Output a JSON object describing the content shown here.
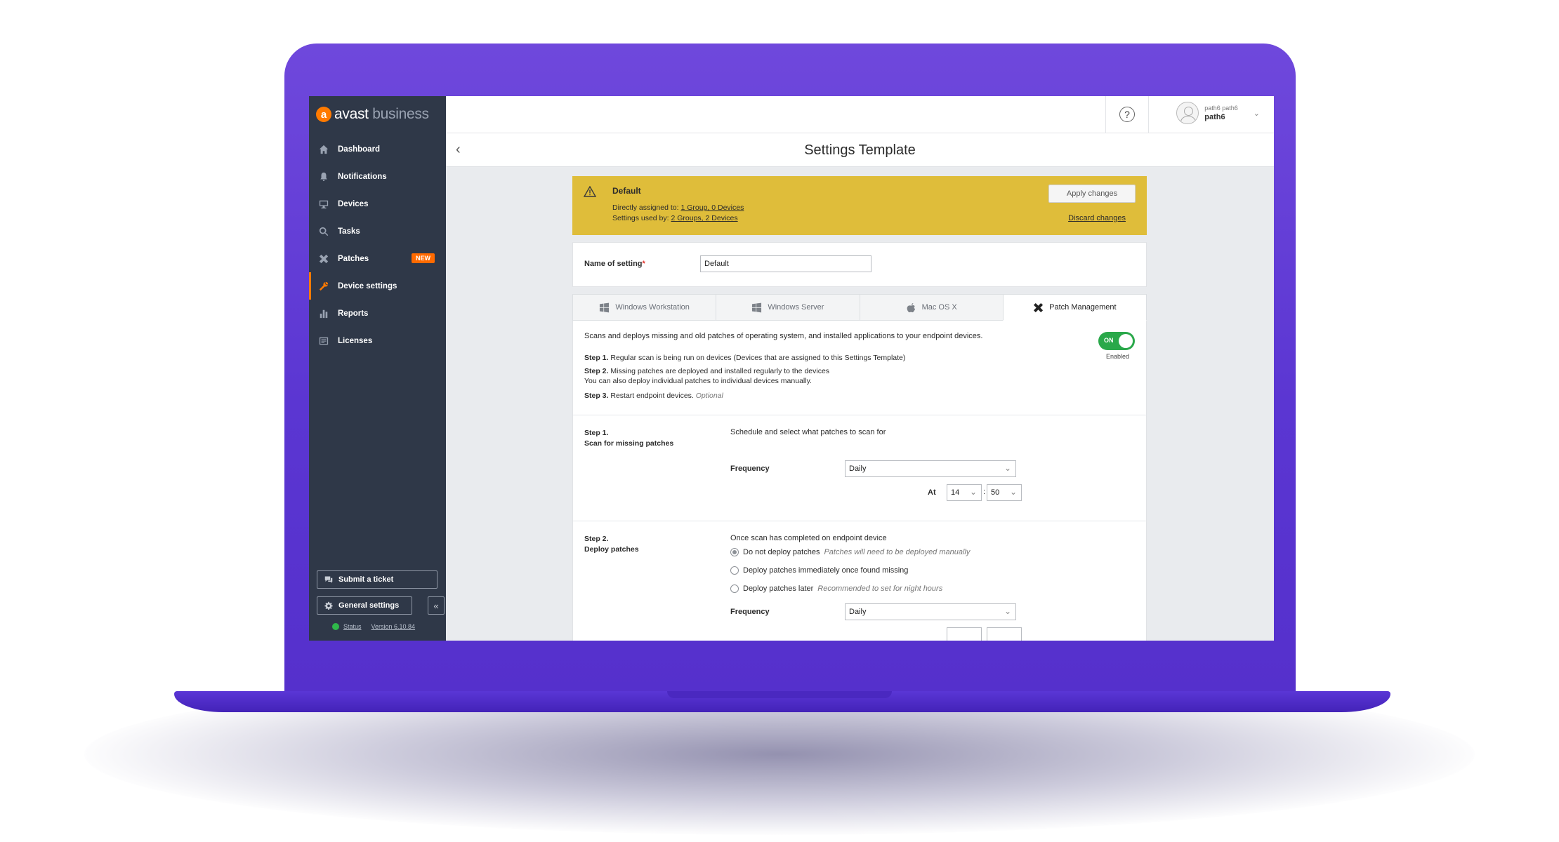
{
  "sidebar": {
    "logo_brand": "avast",
    "logo_product": "business",
    "items": [
      {
        "label": "Dashboard",
        "icon": "home-icon"
      },
      {
        "label": "Notifications",
        "icon": "bell-icon"
      },
      {
        "label": "Devices",
        "icon": "monitor-icon"
      },
      {
        "label": "Tasks",
        "icon": "search-icon"
      },
      {
        "label": "Patches",
        "icon": "patch-icon",
        "badge": "NEW"
      },
      {
        "label": "Device settings",
        "icon": "wrench-icon",
        "active": true
      },
      {
        "label": "Reports",
        "icon": "bar-chart-icon"
      },
      {
        "label": "Licenses",
        "icon": "license-icon"
      }
    ],
    "submit_ticket": "Submit a ticket",
    "general_settings": "General settings",
    "status_link": "Status",
    "version_link": "Version 6.10.84"
  },
  "topbar": {
    "help": "?",
    "user_small": "path6 path6",
    "user_name": "path6"
  },
  "page": {
    "title": "Settings Template"
  },
  "banner": {
    "title": "Default",
    "assigned_prefix": "Directly assigned to:",
    "assigned_link": "1 Group, 0 Devices",
    "used_prefix": "Settings used by:",
    "used_link": "2 Groups, 2 Devices",
    "apply_button": "Apply changes",
    "discard_link": "Discard changes",
    "color": "#dfbd3a"
  },
  "name_setting": {
    "label": "Name of setting",
    "required": "*",
    "value": "Default"
  },
  "tabs": [
    {
      "label": "Windows Workstation",
      "icon": "windows-icon"
    },
    {
      "label": "Windows Server",
      "icon": "windows-icon"
    },
    {
      "label": "Mac OS X",
      "icon": "apple-icon"
    },
    {
      "label": "Patch Management",
      "icon": "patch-icon",
      "active": true
    }
  ],
  "intro": {
    "description": "Scans and deploys missing and old patches of operating system, and installed applications to your endpoint devices.",
    "step1_label": "Step 1.",
    "step1_text": "Regular scan is being run on devices (Devices that are assigned to this Settings Template)",
    "step2_label": "Step 2.",
    "step2_text": "Missing patches are deployed and installed regularly to the devices",
    "step2_extra": "You can also deploy individual patches to individual devices manually.",
    "step3_label": "Step 3.",
    "step3_text": "Restart endpoint devices.",
    "step3_optional": "Optional",
    "toggle_label": "ON",
    "toggle_caption": "Enabled",
    "toggle_color": "#2aa84a"
  },
  "step1": {
    "title_line1": "Step 1.",
    "title_line2": "Scan for missing patches",
    "description": "Schedule and select what patches to scan for",
    "frequency_label": "Frequency",
    "frequency_value": "Daily",
    "at_label": "At",
    "hour": "14",
    "minute": "50"
  },
  "step2": {
    "title_line1": "Step 2.",
    "title_line2": "Deploy patches",
    "description": "Once scan has completed on endpoint device",
    "options": [
      {
        "label": "Do not deploy patches",
        "hint": "Patches will need to be deployed manually",
        "checked": true
      },
      {
        "label": "Deploy patches immediately once found missing",
        "hint": ""
      },
      {
        "label": "Deploy patches later",
        "hint": "Recommended to set for night hours"
      }
    ],
    "frequency_label": "Frequency",
    "frequency_value": "Daily"
  }
}
